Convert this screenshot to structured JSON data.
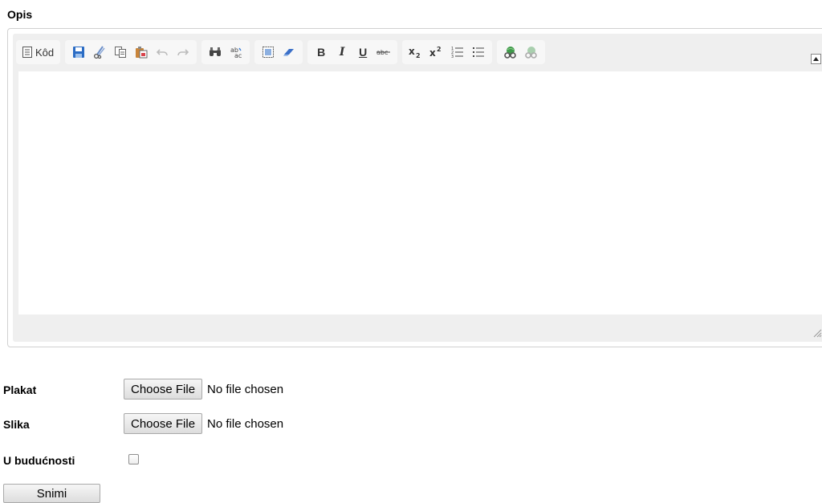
{
  "labels": {
    "opis": "Opis",
    "plakat": "Plakat",
    "slika": "Slika",
    "u_buducnosti": "U budućnosti"
  },
  "editor": {
    "source_label": "Kôd",
    "toolbar_groups": [
      [
        "source"
      ],
      [
        "save-icon",
        "cut-icon",
        "copy-icon",
        "paste-icon",
        "undo-icon",
        "redo-icon"
      ],
      [
        "find-icon",
        "replace-icon"
      ],
      [
        "select-all-icon",
        "remove-format-icon"
      ],
      [
        "bold-icon",
        "italic-icon",
        "underline-icon",
        "strikethrough-icon"
      ],
      [
        "subscript-icon",
        "superscript-icon",
        "numbered-list-icon",
        "bulleted-list-icon"
      ],
      [
        "link-icon",
        "unlink-icon"
      ]
    ],
    "content": ""
  },
  "file_inputs": {
    "plakat": {
      "button": "Choose File",
      "status": "No file chosen"
    },
    "slika": {
      "button": "Choose File",
      "status": "No file chosen"
    }
  },
  "u_buducnosti_checked": false,
  "submit_label": "Snimi"
}
